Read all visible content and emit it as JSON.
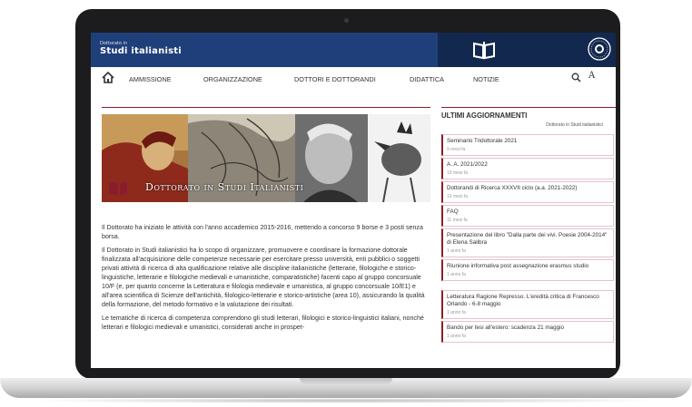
{
  "header": {
    "site_subtitle": "Dottorato in",
    "site_title": "Studi italianisti",
    "colors": {
      "primary": "#1f3f7a",
      "dark": "#13284f",
      "accent": "#8a1d2c"
    }
  },
  "nav": {
    "home_icon": "home-icon",
    "items": [
      "AMMISSIONE",
      "ORGANIZZAZIONE",
      "DOTTORI E DOTTORANDI",
      "DIDATTICA",
      "NOTIZIE"
    ],
    "font_size_label": "A"
  },
  "banner": {
    "caption": "Dottorato in Studi Italianisti"
  },
  "content": {
    "paragraphs": [
      "Il Dottorato ha iniziato le attività con l'anno accademico 2015-2016, mettendo a concorso 9 borse e 3 posti senza borsa.",
      "Il Dottorato in Studi italianistici ha lo scopo di organizzare, promuovere e coordinare la formazione dottorale finalizzata all'acquisizione delle competenze necessarie per esercitare presso università, enti pubblici o soggetti privati attività di ricerca di alta qualificazione relative alle discipline italianistiche (letterarie, filologiche e storico-linguistiche, letterarie e filologiche medievali e umanistiche, comparatistiche) facenti capo al gruppo concorsuale 10/F (e, per quanto concerne la Letteratura e filologia medievale e umanistica, al gruppo concorsuale 10/E1) e all'area scientifica di Scienze dell'antichità, filologico-letterarie e storico-artistiche (area 10), assicurando la qualità della formazione, del metodo formativo e la valutazione dei risultati.",
      "Le tematiche di ricerca di competenza comprendono gli studi letterari, filologici e storico-linguistici italiani, nonché letterari e filologici medievali e umanistici, considerati anche in prospet-"
    ]
  },
  "aside": {
    "title": "ULTIMI AGGIORNAMENTI",
    "subtitle": "Dottorato in Studi italianistici",
    "items": [
      {
        "title": "Seminario Tridottorale 2021",
        "date": "9 mesi fa"
      },
      {
        "title": "A. A. 2021/2022",
        "date": "10 mesi fa"
      },
      {
        "title": "Dottorandi di Ricerca XXXVII ciclo (a.a. 2021-2022)",
        "date": "10 mesi fa"
      },
      {
        "title": "FAQ",
        "date": "11 mesi fa"
      },
      {
        "title": "Presentazione del libro \"Dalla parte dei vivi. Poesie 2004-2014\" di Elena Salibra",
        "date": "1 anno fa"
      },
      {
        "title": "Riunione informativa post assegnazione erasmus studio",
        "date": "1 anno fa"
      },
      {
        "title": "Letteratura Ragione Represso. L'eredità critica di Francesco Orlando - 6-8 maggio",
        "date": "1 anno fa"
      },
      {
        "title": "Bando per tesi all'estero: scadenza 21 maggio",
        "date": "1 anno fa"
      }
    ]
  }
}
